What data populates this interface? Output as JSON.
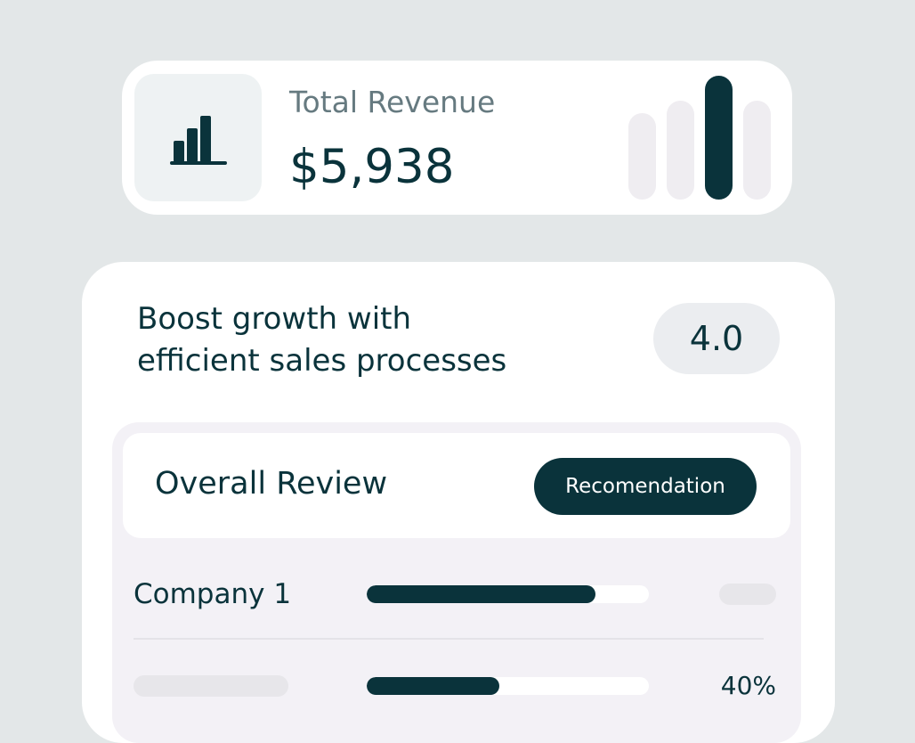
{
  "revenue": {
    "label": "Total Revenue",
    "value": "$5,938",
    "icon": "bar-chart-icon",
    "mini_bars": [
      {
        "level": 0.7,
        "active": false
      },
      {
        "level": 0.8,
        "active": false
      },
      {
        "level": 1.0,
        "active": true
      },
      {
        "level": 0.8,
        "active": false
      }
    ]
  },
  "card": {
    "headline_line1": "Boost growth with",
    "headline_line2": "efficient sales processes",
    "rating": "4.0"
  },
  "review": {
    "title": "Overall Review",
    "button_label": "Recomendation",
    "rows": [
      {
        "name": "Company 1",
        "progress": 0.81,
        "value": ""
      },
      {
        "name": "",
        "progress": 0.47,
        "value": "40%"
      }
    ]
  },
  "colors": {
    "primary": "#0a333b",
    "background": "#e3e7e8",
    "muted_text": "#667a80",
    "placeholder": "#e7e6ea",
    "inactive_bar": "#efedf1"
  }
}
